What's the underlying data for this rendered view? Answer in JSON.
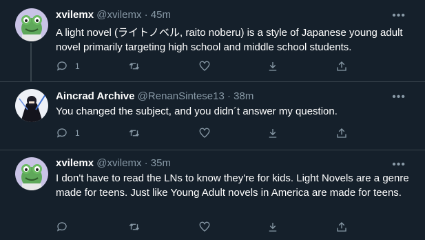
{
  "tweets": [
    {
      "name": "xvilemx",
      "handle": "@xvilemx",
      "time": "45m",
      "text": "A light novel (ライトノベル, raito noberu) is a style of Japanese young adult novel primarily targeting high school and middle school students.",
      "reply_count": "1",
      "avatar": "frog-avatar"
    },
    {
      "name": "Aincrad Archive",
      "handle": "@RenanSintese13",
      "time": "38m",
      "text": "You changed the subject, and you didn´t answer my question.",
      "reply_count": "1",
      "avatar": "anime-character-avatar"
    },
    {
      "name": "xvilemx",
      "handle": "@xvilemx",
      "time": "35m",
      "text": "I don't have to read the LNs to know they're for kids. Light Novels are a genre made for teens. Just like Young Adult novels in America are made for teens.",
      "reply_count": "",
      "avatar": "frog-avatar"
    }
  ],
  "separator": "·",
  "more_glyph": "•••",
  "colors": {
    "background": "#15202b",
    "text_primary": "#ffffff",
    "text_secondary": "#8899a6",
    "divider": "#38444d"
  },
  "icons": [
    "reply-icon",
    "retweet-icon",
    "like-icon",
    "download-icon",
    "share-icon",
    "more-icon"
  ]
}
